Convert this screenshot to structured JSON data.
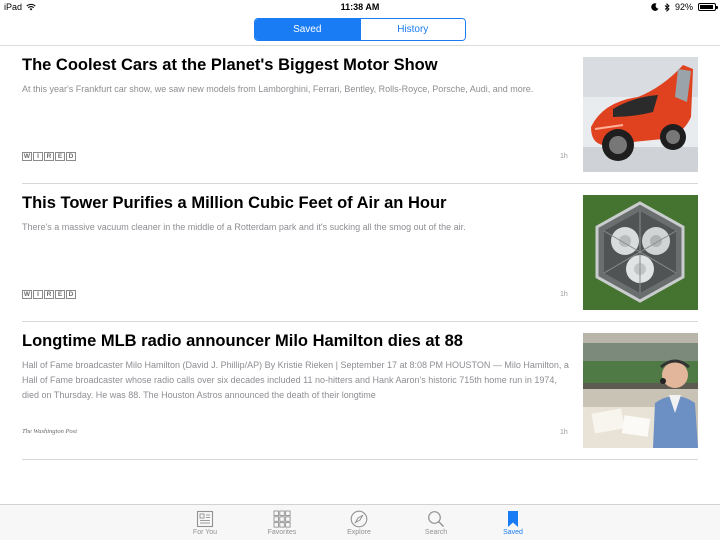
{
  "status_bar": {
    "device": "iPad",
    "time": "11:38 AM",
    "battery": "92%",
    "battery_level": 0.92
  },
  "segmented": {
    "options": [
      "Saved",
      "History"
    ],
    "selected": "Saved"
  },
  "articles": [
    {
      "title": "The Coolest Cars at the Planet's Biggest Motor Show",
      "summary": "At this year's Frankfurt car show, we saw new models from Lamborghini, Ferrari, Bentley, Rolls-Royce, Porsche, Audi, and more.",
      "source": "WIRED",
      "age": "1h",
      "image": "red-concept-car"
    },
    {
      "title": "This Tower Purifies a Million Cubic Feet of Air an Hour",
      "summary": "There's a massive vacuum cleaner in the middle of a Rotterdam park and it's sucking all the smog out of the air.",
      "source": "WIRED",
      "age": "1h",
      "image": "hexagonal-smog-tower"
    },
    {
      "title": "Longtime MLB radio announcer Milo Hamilton dies at 88",
      "summary": "Hall of Fame broadcaster Milo Hamilton (David J. Phillip/AP) By Kristie Rieken | September 17 at 8:08 PM HOUSTON — Milo Hamilton, a Hall of Fame broadcaster whose radio calls over six decades included 11 no-hitters and Hank Aaron's historic 715th home run in 1974, died on Thursday. He was 88. The Houston Astros announced the death of their longtime",
      "source": "The Washington Post",
      "age": "1h",
      "image": "broadcaster-in-booth"
    }
  ],
  "tab_bar": {
    "items": [
      {
        "label": "For You",
        "icon": "news-icon"
      },
      {
        "label": "Favorites",
        "icon": "grid-icon"
      },
      {
        "label": "Explore",
        "icon": "compass-icon"
      },
      {
        "label": "Search",
        "icon": "search-icon"
      },
      {
        "label": "Saved",
        "icon": "bookmark-icon"
      }
    ],
    "selected": "Saved"
  },
  "colors": {
    "accent": "#1a7cf5",
    "summary_text": "#8e8e93",
    "divider": "#d8d8d8"
  }
}
